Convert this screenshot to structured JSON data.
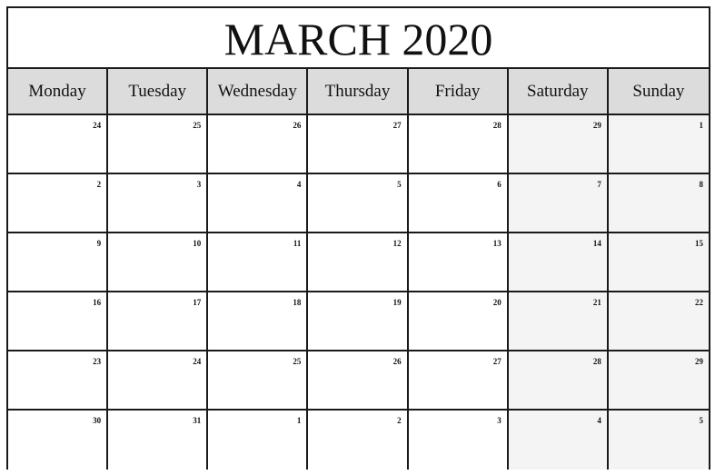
{
  "title": "MARCH 2020",
  "colors": {
    "header_bg": "#dcdcdc",
    "weekend_bg": "#f4f4f4",
    "border": "#1a1a1a"
  },
  "weekdays": [
    "Monday",
    "Tuesday",
    "Wednesday",
    "Thursday",
    "Friday",
    "Saturday",
    "Sunday"
  ],
  "weeks": [
    [
      "24",
      "25",
      "26",
      "27",
      "28",
      "29",
      "1"
    ],
    [
      "2",
      "3",
      "4",
      "5",
      "6",
      "7",
      "8"
    ],
    [
      "9",
      "10",
      "11",
      "12",
      "13",
      "14",
      "15"
    ],
    [
      "16",
      "17",
      "18",
      "19",
      "20",
      "21",
      "22"
    ],
    [
      "23",
      "24",
      "25",
      "26",
      "27",
      "28",
      "29"
    ],
    [
      "30",
      "31",
      "1",
      "2",
      "3",
      "4",
      "5"
    ]
  ]
}
